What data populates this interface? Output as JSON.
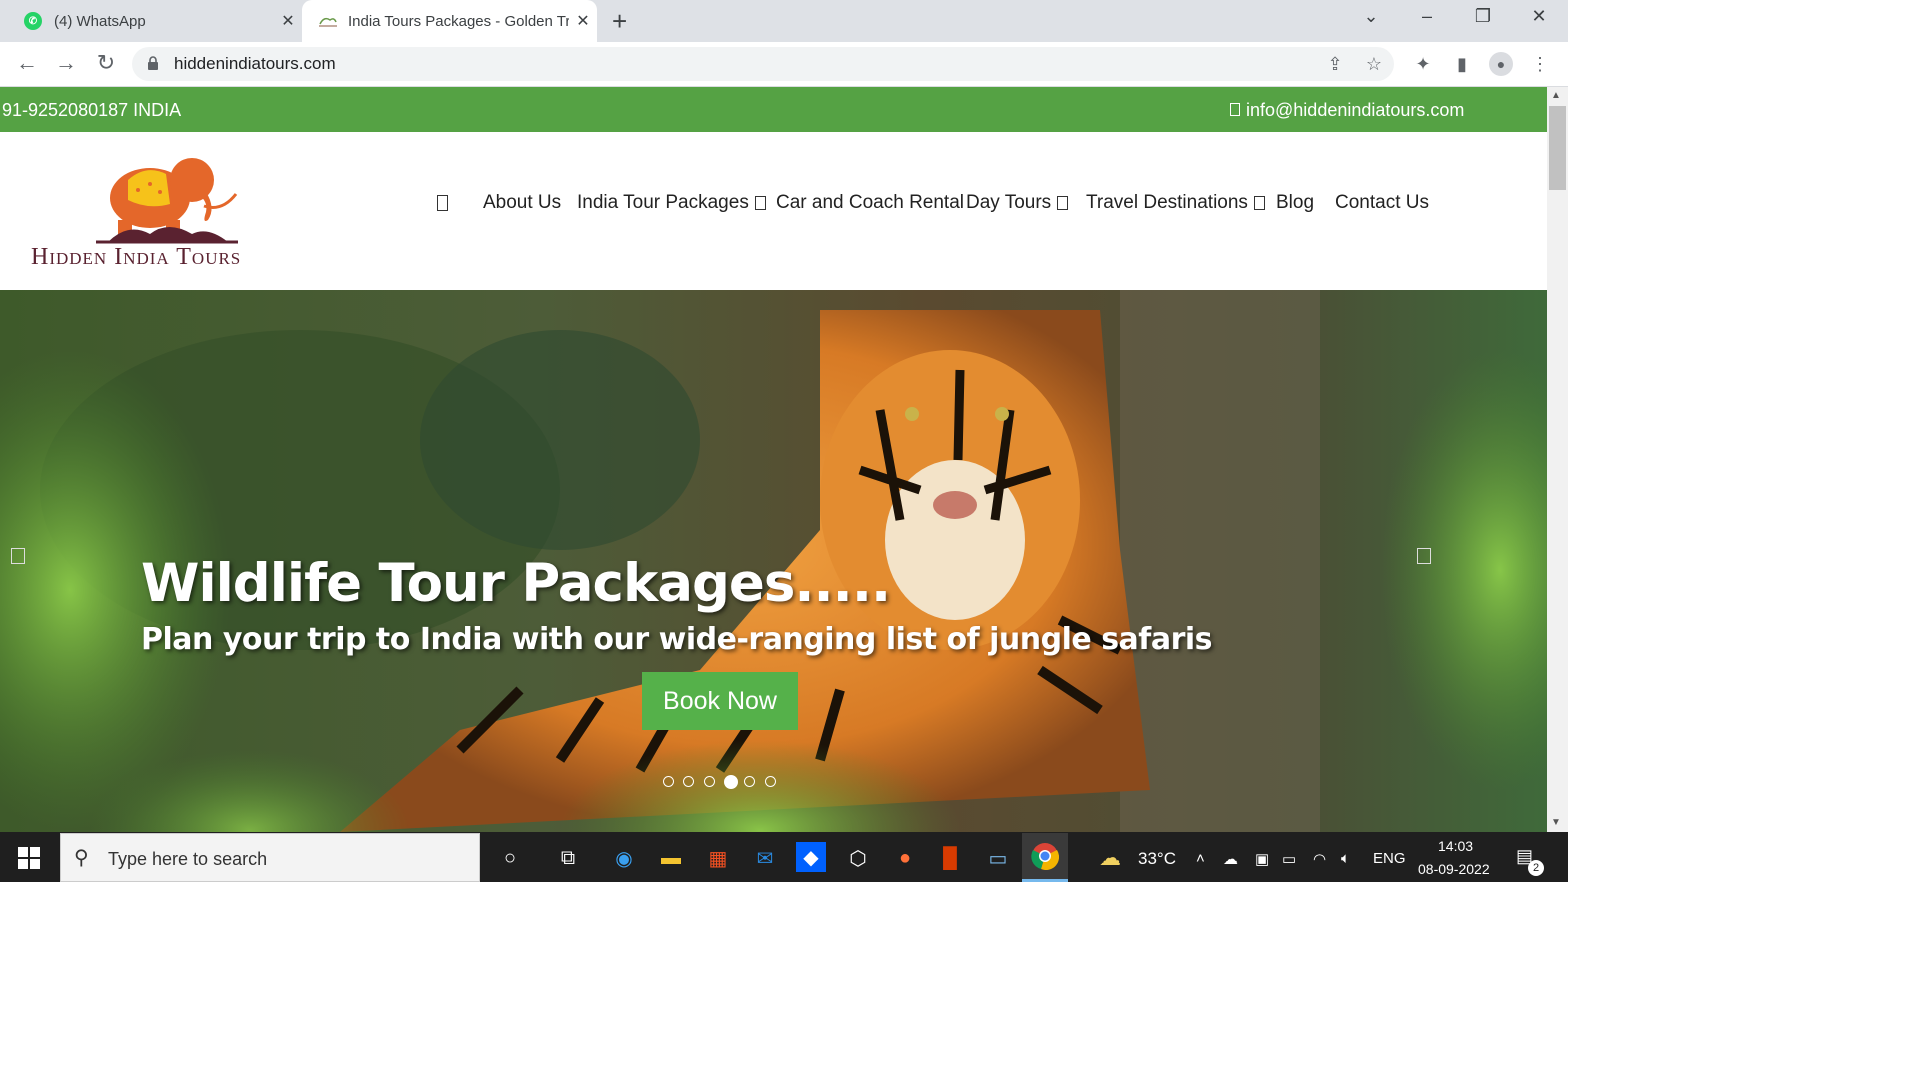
{
  "browser": {
    "tabs": [
      {
        "label": "(4) WhatsApp"
      },
      {
        "label": "India Tours Packages - Golden Tri"
      }
    ],
    "url": "hiddenindiatours.com"
  },
  "topbar": {
    "phone": "91-9252080187 INDIA",
    "email": "info@hiddenindiatours.com"
  },
  "logo": {
    "text": "Hidden India Tours"
  },
  "nav": {
    "items": [
      {
        "label": "About Us"
      },
      {
        "label": "India Tour Packages"
      },
      {
        "label": "Car and Coach Rental"
      },
      {
        "label": "Day Tours"
      },
      {
        "label": "Travel Destinations"
      },
      {
        "label": "Blog"
      },
      {
        "label": "Contact Us"
      }
    ]
  },
  "hero": {
    "title": "Wildlife Tour Packages.....",
    "subtitle": "Plan your trip to India with our wide-ranging list of jungle safaris",
    "cta": "Book Now",
    "slides": 6,
    "active_slide": 4
  },
  "taskbar": {
    "search_placeholder": "Type here to search",
    "weather": "33°C",
    "language": "ENG",
    "time": "14:03",
    "date": "08-09-2022",
    "notifications": "2"
  },
  "colors": {
    "brand_green": "#55a244",
    "button_green": "#55b14a",
    "logo_orange": "#e4672a",
    "logo_text": "#5a2230"
  }
}
